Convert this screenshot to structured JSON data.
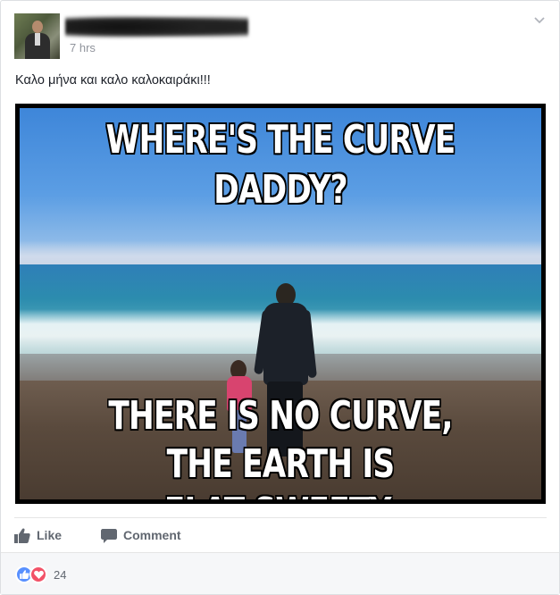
{
  "post": {
    "timestamp": "7 hrs",
    "text": "Καλο μήνα και καλο καλοκαιράκι!!!",
    "image": {
      "top_caption": "WHERE'S THE CURVE DADDY?",
      "bottom_caption_line1": "THERE IS NO CURVE, THE EARTH IS",
      "bottom_caption_line2": "FLAT SWEETY."
    }
  },
  "actions": {
    "like_label": "Like",
    "comment_label": "Comment"
  },
  "reactions": {
    "types": [
      "like-icon",
      "love-icon"
    ],
    "count": "24"
  },
  "colors": {
    "like_blue": "#5890ff",
    "love_red": "#f25268",
    "action_grey": "#616770"
  }
}
